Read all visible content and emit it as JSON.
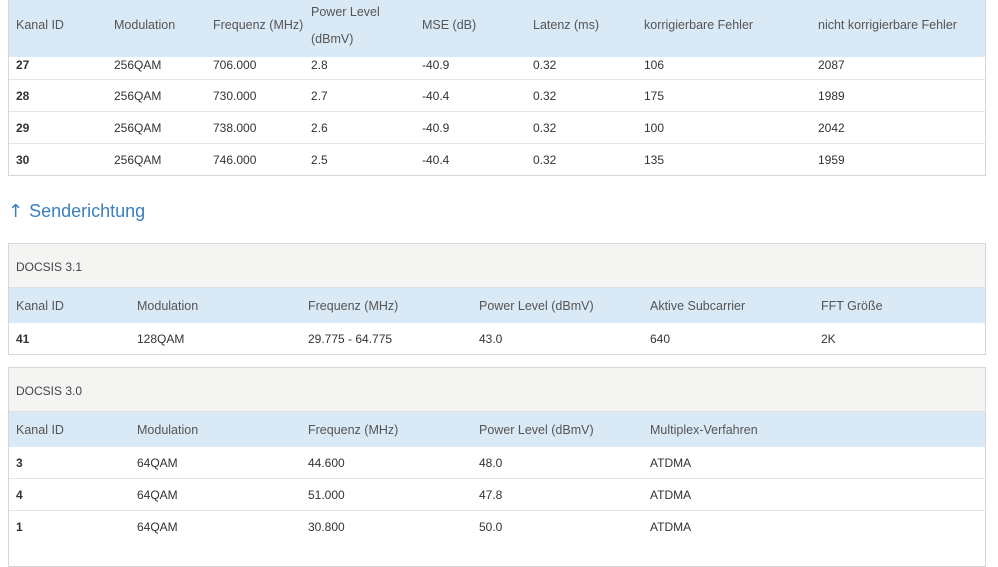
{
  "downstream": {
    "headers": [
      "Kanal ID",
      "Modulation",
      "Frequenz (MHz)",
      "Power Level",
      "(dBmV)",
      "MSE (dB)",
      "Latenz (ms)",
      "korrigierbare Fehler",
      "nicht korrigierbare Fehler"
    ],
    "rows": [
      [
        "27",
        "256QAM",
        "706.000",
        "2.8",
        "-40.9",
        "0.32",
        "106",
        "2087"
      ],
      [
        "28",
        "256QAM",
        "730.000",
        "2.7",
        "-40.4",
        "0.32",
        "175",
        "1989"
      ],
      [
        "29",
        "256QAM",
        "738.000",
        "2.6",
        "-40.9",
        "0.32",
        "100",
        "2042"
      ],
      [
        "30",
        "256QAM",
        "746.000",
        "2.5",
        "-40.4",
        "0.32",
        "135",
        "1959"
      ]
    ]
  },
  "upstream": {
    "title_arrow": "↑",
    "title": "Senderichtung",
    "docsis31": {
      "label": "DOCSIS 3.1",
      "headers": [
        "Kanal ID",
        "Modulation",
        "Frequenz (MHz)",
        "Power Level (dBmV)",
        "Aktive Subcarrier",
        "FFT Größe"
      ],
      "rows": [
        [
          "41",
          "128QAM",
          "29.775 - 64.775",
          "43.0",
          "640",
          "2K"
        ]
      ]
    },
    "docsis30": {
      "label": "DOCSIS 3.0",
      "headers": [
        "Kanal ID",
        "Modulation",
        "Frequenz (MHz)",
        "Power Level (dBmV)",
        "Multiplex-Verfahren"
      ],
      "rows": [
        [
          "3",
          "64QAM",
          "44.600",
          "48.0",
          "ATDMA"
        ],
        [
          "4",
          "64QAM",
          "51.000",
          "47.8",
          "ATDMA"
        ],
        [
          "1",
          "64QAM",
          "30.800",
          "50.0",
          "ATDMA"
        ]
      ]
    }
  }
}
